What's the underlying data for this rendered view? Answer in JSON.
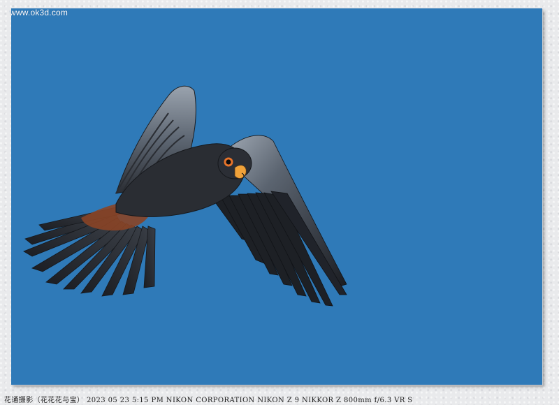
{
  "watermark": "www.ok3d.com",
  "photo": {
    "sky_color": "#2f7ab8",
    "subject": "falcon-in-flight"
  },
  "caption": "花通摄影（花花花与宝） 2023 05 23   5:15 PM  NIKON CORPORATION NIKON Z 9 NIKKOR Z 800mm f/6.3 VR S",
  "colors": {
    "bird_dark": "#23262c",
    "bird_grey": "#6c7684",
    "eye_ring": "#e8742a",
    "vent_rust": "#9a4a2a"
  }
}
